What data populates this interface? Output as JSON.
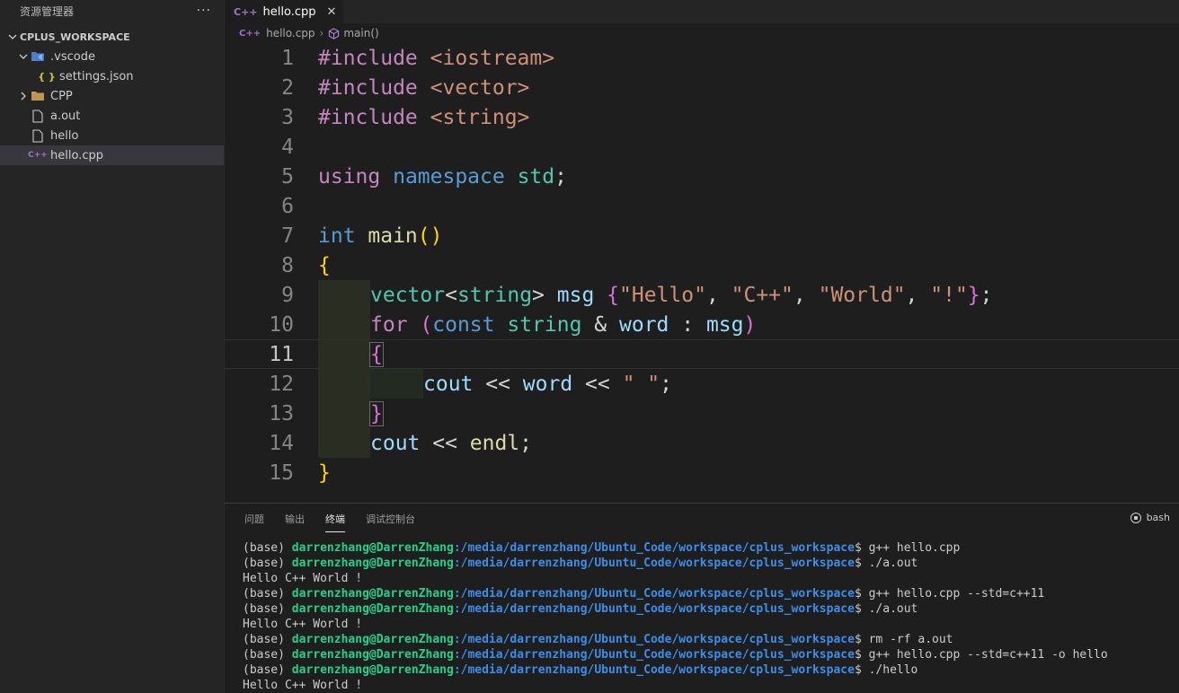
{
  "colors": {
    "accent": "#569cd6",
    "cpp_icon": "#a074c4",
    "terminal_user": "#23d18b",
    "terminal_path": "#3b8eea"
  },
  "sidebar": {
    "title": "资源管理器",
    "more": "···",
    "workspace": "CPLUS_WORKSPACE",
    "items": [
      {
        "label": ".vscode",
        "icon": "vscode-folder-icon"
      },
      {
        "label": "settings.json",
        "icon": "json-icon",
        "glyph": "{ }"
      },
      {
        "label": "CPP",
        "icon": "folder-icon"
      },
      {
        "label": "a.out",
        "icon": "file-icon"
      },
      {
        "label": "hello",
        "icon": "file-icon"
      },
      {
        "label": "hello.cpp",
        "icon": "cpp-file-icon",
        "glyph": "C++"
      }
    ]
  },
  "tab": {
    "label": "hello.cpp",
    "close": "✕"
  },
  "breadcrumb": {
    "file": "hello.cpp",
    "symbol": "main()"
  },
  "code": {
    "line_numbers": [
      "1",
      "2",
      "3",
      "4",
      "5",
      "6",
      "7",
      "8",
      "9",
      "10",
      "11",
      "12",
      "13",
      "14",
      "15"
    ],
    "active_line": 11,
    "l1": [
      "#include",
      " <iostream>"
    ],
    "l2": [
      "#include",
      " <vector>"
    ],
    "l3": [
      "#include",
      " <string>"
    ],
    "l5": [
      "using",
      " namespace",
      " std",
      ";"
    ],
    "l7": [
      "int",
      " main",
      "(",
      ")"
    ],
    "l8": [
      "{"
    ],
    "l9": [
      "vector",
      "<",
      "string",
      ">",
      " msg ",
      "{",
      "\"Hello\"",
      ", ",
      "\"C++\"",
      ", ",
      "\"World\"",
      ", ",
      "\"!\"",
      "}",
      ";"
    ],
    "l10": [
      "for",
      " ",
      "(",
      "const",
      " string",
      " & ",
      "word",
      " : ",
      "msg",
      ")"
    ],
    "l11": [
      "{"
    ],
    "l12": [
      "cout",
      " << ",
      "word",
      " << ",
      "\" \"",
      ";"
    ],
    "l13": [
      "}"
    ],
    "l14": [
      "cout",
      " << ",
      "endl",
      ";"
    ],
    "l15": [
      "}"
    ]
  },
  "panel": {
    "tabs": [
      "问题",
      "输出",
      "终端",
      "调试控制台"
    ],
    "active_tab": "终端",
    "shell": "bash",
    "terminal": [
      {
        "prefix": "(base) ",
        "user": "darrenzhang@DarrenZhang",
        "path": ":/media/darrenzhang/Ubuntu_Code/workspace/cplus_workspace",
        "cmd": "$ g++ hello.cpp"
      },
      {
        "prefix": "(base) ",
        "user": "darrenzhang@DarrenZhang",
        "path": ":/media/darrenzhang/Ubuntu_Code/workspace/cplus_workspace",
        "cmd": "$ ./a.out"
      },
      {
        "output": "Hello C++ World !"
      },
      {
        "prefix": "(base) ",
        "user": "darrenzhang@DarrenZhang",
        "path": ":/media/darrenzhang/Ubuntu_Code/workspace/cplus_workspace",
        "cmd": "$ g++ hello.cpp --std=c++11"
      },
      {
        "prefix": "(base) ",
        "user": "darrenzhang@DarrenZhang",
        "path": ":/media/darrenzhang/Ubuntu_Code/workspace/cplus_workspace",
        "cmd": "$ ./a.out"
      },
      {
        "output": "Hello C++ World !"
      },
      {
        "prefix": "(base) ",
        "user": "darrenzhang@DarrenZhang",
        "path": ":/media/darrenzhang/Ubuntu_Code/workspace/cplus_workspace",
        "cmd": "$ rm -rf a.out"
      },
      {
        "prefix": "(base) ",
        "user": "darrenzhang@DarrenZhang",
        "path": ":/media/darrenzhang/Ubuntu_Code/workspace/cplus_workspace",
        "cmd": "$ g++ hello.cpp --std=c++11 -o hello"
      },
      {
        "prefix": "(base) ",
        "user": "darrenzhang@DarrenZhang",
        "path": ":/media/darrenzhang/Ubuntu_Code/workspace/cplus_workspace",
        "cmd": "$ ./hello"
      },
      {
        "output": "Hello C++ World !"
      }
    ]
  }
}
